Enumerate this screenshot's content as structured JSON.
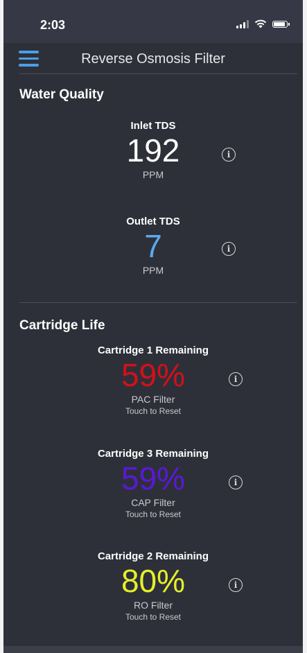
{
  "status": {
    "time": "2:03"
  },
  "header": {
    "title": "Reverse Osmosis Filter"
  },
  "water_quality": {
    "title": "Water Quality",
    "inlet": {
      "label": "Inlet TDS",
      "value": "192",
      "unit": "PPM",
      "color": "#ffffff"
    },
    "outlet": {
      "label": "Outlet TDS",
      "value": "7",
      "unit": "PPM",
      "color": "#5aa9ee"
    }
  },
  "cartridge_life": {
    "title": "Cartridge Life",
    "items": [
      {
        "label": "Cartridge 1 Remaining",
        "value": "59%",
        "filter": "PAC Filter",
        "reset": "Touch to Reset",
        "color": "#d3101a"
      },
      {
        "label": "Cartridge 3 Remaining",
        "value": "59%",
        "filter": "CAP Filter",
        "reset": "Touch to Reset",
        "color": "#5a18d8"
      },
      {
        "label": "Cartridge 2 Remaining",
        "value": "80%",
        "filter": "RO Filter",
        "reset": "Touch to Reset",
        "color": "#e6ef2a"
      }
    ]
  },
  "icons": {
    "info": "i"
  }
}
